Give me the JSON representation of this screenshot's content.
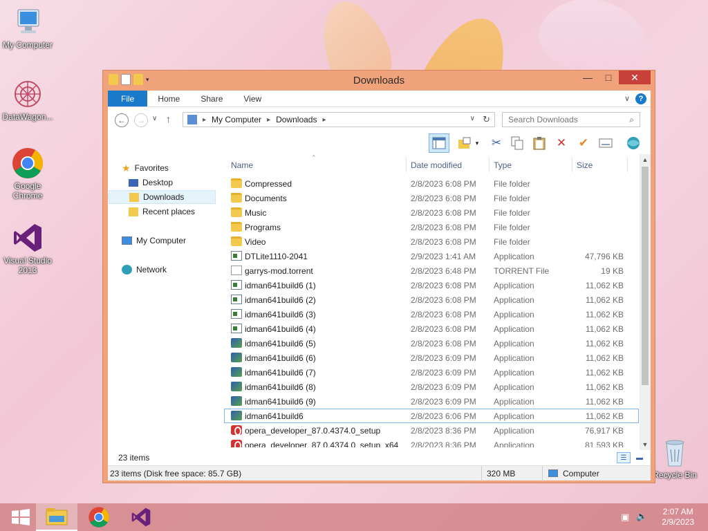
{
  "desktop": {
    "icons": [
      {
        "label": "My Computer"
      },
      {
        "label": "DataWagon..."
      },
      {
        "label": "Google Chrome"
      },
      {
        "label": "Visual Studio 2013"
      },
      {
        "label": "Recycle Bin"
      }
    ]
  },
  "window": {
    "title": "Downloads",
    "controls": {
      "minimize": "—",
      "maximize": "□",
      "close": "✕"
    }
  },
  "ribbon": {
    "tabs": [
      "File",
      "Home",
      "Share",
      "View"
    ],
    "expand_glyph": "∨",
    "help_glyph": "?"
  },
  "address": {
    "back": "←",
    "forward": "→",
    "recent_dropdown": "∨",
    "up": "↑",
    "crumbs": [
      "My Computer",
      "Downloads"
    ],
    "separator": "▸",
    "dropdown": "∨",
    "refresh": "↻"
  },
  "search": {
    "placeholder": "Search Downloads",
    "icon": "⌕"
  },
  "toolbar": {
    "icons": [
      "preview-pane-icon",
      "folder-options-icon",
      "dropdown-icon",
      "cut-icon",
      "copy-icon",
      "paste-icon",
      "delete-icon",
      "rename-check-icon",
      "properties-icon",
      "network-icon"
    ]
  },
  "nav": {
    "favorites": "Favorites",
    "desktop": "Desktop",
    "downloads": "Downloads",
    "recent": "Recent places",
    "computer": "My Computer",
    "network": "Network"
  },
  "columns": {
    "name": "Name",
    "date": "Date modified",
    "type": "Type",
    "size": "Size"
  },
  "files": [
    {
      "name": "Compressed",
      "date": "2/8/2023 6:08 PM",
      "type": "File folder",
      "size": "",
      "icon": "folder"
    },
    {
      "name": "Documents",
      "date": "2/8/2023 6:08 PM",
      "type": "File folder",
      "size": "",
      "icon": "folder"
    },
    {
      "name": "Music",
      "date": "2/8/2023 6:08 PM",
      "type": "File folder",
      "size": "",
      "icon": "folder"
    },
    {
      "name": "Programs",
      "date": "2/8/2023 6:08 PM",
      "type": "File folder",
      "size": "",
      "icon": "folder"
    },
    {
      "name": "Video",
      "date": "2/8/2023 6:08 PM",
      "type": "File folder",
      "size": "",
      "icon": "folder"
    },
    {
      "name": "DTLite1110-2041",
      "date": "2/9/2023 1:41 AM",
      "type": "Application",
      "size": "47,796 KB",
      "icon": "app"
    },
    {
      "name": "garrys-mod.torrent",
      "date": "2/8/2023 6:48 PM",
      "type": "TORRENT File",
      "size": "19 KB",
      "icon": "torrent"
    },
    {
      "name": "idman641build6 (1)",
      "date": "2/8/2023 6:08 PM",
      "type": "Application",
      "size": "11,062 KB",
      "icon": "app"
    },
    {
      "name": "idman641build6 (2)",
      "date": "2/8/2023 6:08 PM",
      "type": "Application",
      "size": "11,062 KB",
      "icon": "app"
    },
    {
      "name": "idman641build6 (3)",
      "date": "2/8/2023 6:08 PM",
      "type": "Application",
      "size": "11,062 KB",
      "icon": "app"
    },
    {
      "name": "idman641build6 (4)",
      "date": "2/8/2023 6:08 PM",
      "type": "Application",
      "size": "11,062 KB",
      "icon": "app"
    },
    {
      "name": "idman641build6 (5)",
      "date": "2/8/2023 6:08 PM",
      "type": "Application",
      "size": "11,062 KB",
      "icon": "idm"
    },
    {
      "name": "idman641build6 (6)",
      "date": "2/8/2023 6:09 PM",
      "type": "Application",
      "size": "11,062 KB",
      "icon": "idm"
    },
    {
      "name": "idman641build6 (7)",
      "date": "2/8/2023 6:09 PM",
      "type": "Application",
      "size": "11,062 KB",
      "icon": "idm"
    },
    {
      "name": "idman641build6 (8)",
      "date": "2/8/2023 6:09 PM",
      "type": "Application",
      "size": "11,062 KB",
      "icon": "idm"
    },
    {
      "name": "idman641build6 (9)",
      "date": "2/8/2023 6:09 PM",
      "type": "Application",
      "size": "11,062 KB",
      "icon": "idm"
    },
    {
      "name": "idman641build6",
      "date": "2/8/2023 6:06 PM",
      "type": "Application",
      "size": "11,062 KB",
      "icon": "idm",
      "selected": true
    },
    {
      "name": "opera_developer_87.0.4374.0_setup",
      "date": "2/8/2023 8:36 PM",
      "type": "Application",
      "size": "76,917 KB",
      "icon": "opera"
    },
    {
      "name": "opera_developer_87.0.4374.0_setup_x64",
      "date": "2/8/2023 8:36 PM",
      "type": "Application",
      "size": "81,593 KB",
      "icon": "opera"
    }
  ],
  "status": {
    "item_count": "23 items",
    "disk_info": "23 items (Disk free space: 85.7 GB)",
    "selection_size": "320 MB",
    "location": "Computer"
  },
  "taskbar": {
    "clock_time": "2:07 AM",
    "clock_date": "2/9/2023",
    "items": [
      "start",
      "file-explorer",
      "chrome",
      "visual-studio"
    ]
  },
  "colors": {
    "accent": "#1979ca",
    "window_frame": "#f0a37b",
    "close_button": "#c7403a",
    "taskbar": "#c86e6e"
  }
}
